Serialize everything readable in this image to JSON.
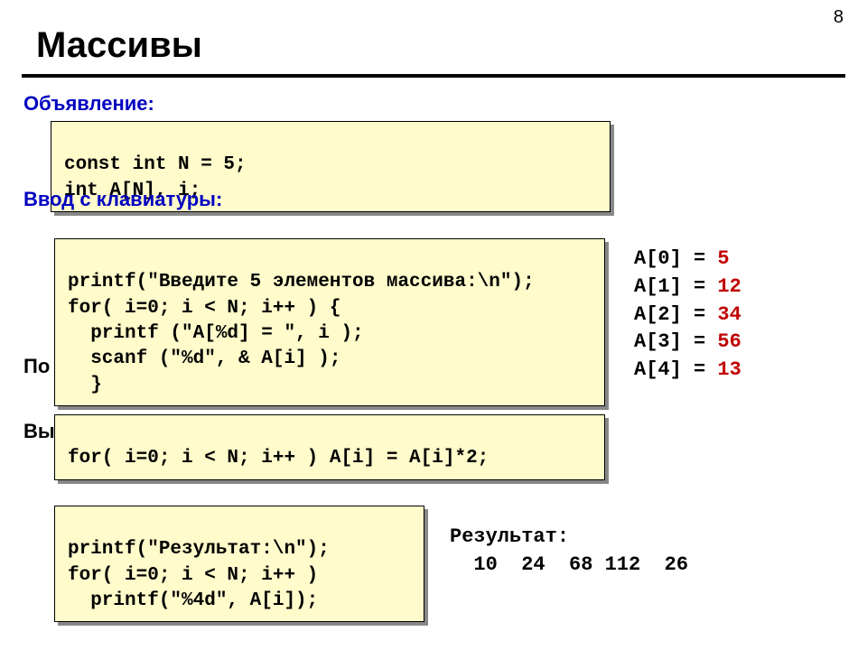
{
  "page_number": "8",
  "title": "Массивы",
  "sections": {
    "declare": "Объявление:",
    "input": "Ввод с клавиатуры:"
  },
  "partial_labels": {
    "po": "По",
    "vy": "Вы"
  },
  "code": {
    "declare_l1": "const int N = 5;",
    "declare_l2": "int A[N], i;",
    "input_l1": "printf(\"Введите 5 элементов массива:\\n\");",
    "input_l2": "for( i=0; i < N; i++ ) {",
    "input_l3": "  printf (\"A[%d] = \", i );",
    "input_l4": "  scanf (\"%d\", & A[i] );",
    "input_l5": "  }",
    "process_l1": "for( i=0; i < N; i++ ) A[i] = A[i]*2;",
    "output_l1": "printf(\"Результат:\\n\");",
    "output_l2": "for( i=0; i < N; i++ )",
    "output_l3": "  printf(\"%4d\", A[i]);"
  },
  "sample_input": [
    {
      "label": "A[0] =",
      "value": "5"
    },
    {
      "label": "A[1] =",
      "value": "12"
    },
    {
      "label": "A[2] =",
      "value": "34"
    },
    {
      "label": "A[3] =",
      "value": "56"
    },
    {
      "label": "A[4] =",
      "value": "13"
    }
  ],
  "result": {
    "label": "Результат:",
    "line": "  10  24  68 112  26"
  }
}
